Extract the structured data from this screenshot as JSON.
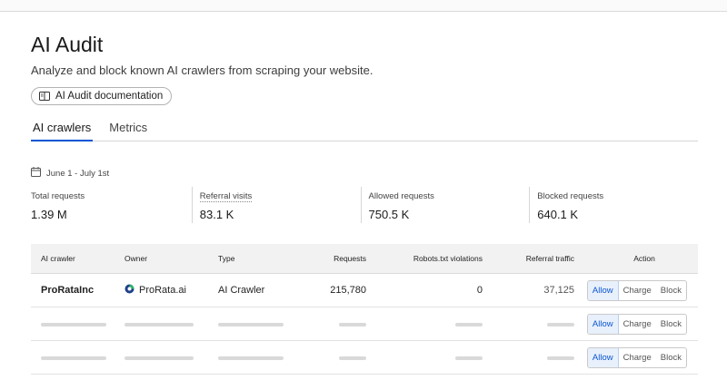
{
  "page": {
    "title": "AI Audit",
    "subtitle": "Analyze and block known AI crawlers from scraping your website.",
    "doc_button_label": "AI Audit documentation"
  },
  "tabs": [
    {
      "label": "AI crawlers",
      "active": true
    },
    {
      "label": "Metrics",
      "active": false
    }
  ],
  "date_range": "June 1 - July 1st",
  "stats": [
    {
      "label": "Total requests",
      "value": "1.39 M"
    },
    {
      "label": "Referral visits",
      "value": "83.1 K"
    },
    {
      "label": "Allowed requests",
      "value": "750.5 K"
    },
    {
      "label": "Blocked requests",
      "value": "640.1 K"
    }
  ],
  "table": {
    "headers": {
      "crawler": "AI crawler",
      "owner": "Owner",
      "type": "Type",
      "requests": "Requests",
      "robots": "Robots.txt violations",
      "referral": "Referral traffic",
      "action": "Action"
    },
    "rows": [
      {
        "crawler": "ProRataInc",
        "owner": "ProRata.ai",
        "type": "AI Crawler",
        "requests": "215,780",
        "robots": "0",
        "referral": "37,125"
      }
    ],
    "actions": {
      "allow": "Allow",
      "charge": "Charge",
      "block": "Block"
    }
  },
  "colors": {
    "accent": "#0055d6",
    "selected_bg": "#e8f0fc",
    "selected_text": "#0b57d0"
  },
  "icons": {
    "doc": "book-icon",
    "calendar": "calendar-icon",
    "owner": "prorata-logo-icon"
  }
}
